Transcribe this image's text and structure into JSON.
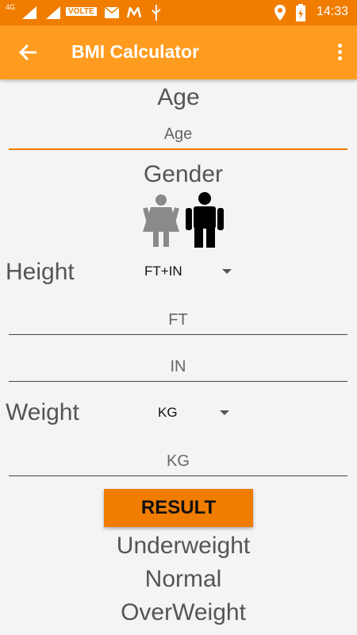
{
  "status_bar": {
    "network_label": "4G",
    "volte_label": "VOLTE",
    "time": "14:33"
  },
  "app_bar": {
    "title": "BMI Calculator"
  },
  "age": {
    "label": "Age",
    "placeholder": "Age"
  },
  "gender": {
    "label": "Gender"
  },
  "height": {
    "label": "Height",
    "unit_selected": "FT+IN",
    "ft_placeholder": "FT",
    "in_placeholder": "IN"
  },
  "weight": {
    "label": "Weight",
    "unit_selected": "KG",
    "kg_placeholder": "KG"
  },
  "result_button": {
    "label": "RESULT"
  },
  "categories": [
    "Underweight",
    "Normal",
    "OverWeight"
  ],
  "colors": {
    "status_bar": "#f07d00",
    "app_bar": "#ff9b1e",
    "accent": "#f07d00"
  }
}
